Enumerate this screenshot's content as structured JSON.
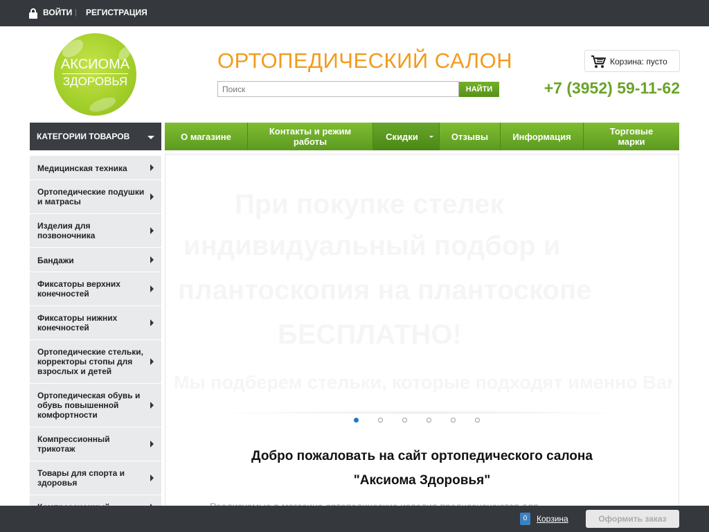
{
  "topbar": {
    "login_label": "ВОЙТИ",
    "separator": "|",
    "register_label": "РЕГИСТРАЦИЯ"
  },
  "logo": {
    "line1": "АКСИОМА",
    "line2": "ЗДОРОВЬЯ"
  },
  "header": {
    "site_title": "ОРТОПЕДИЧЕСКИЙ САЛОН",
    "search_placeholder": "Поиск",
    "search_button": "НАЙТИ",
    "cart_label": "Корзина: пусто",
    "phone": "+7 (3952) 59-11-62"
  },
  "categories_header": "КАТЕГОРИИ ТОВАРОВ",
  "nav": [
    {
      "label": "О магазине"
    },
    {
      "label": "Контакты и режим работы"
    },
    {
      "label": "Скидки"
    },
    {
      "label": "Отзывы"
    },
    {
      "label": "Информация"
    },
    {
      "label": "Торговые марки"
    }
  ],
  "sidebar": {
    "items": [
      {
        "label": "Медицинская техника"
      },
      {
        "label": "Ортопедические подушки и матрасы"
      },
      {
        "label": "Изделия для позвоночника"
      },
      {
        "label": "Бандажи"
      },
      {
        "label": "Фиксаторы верхних конечностей"
      },
      {
        "label": "Фиксаторы нижних конечностей"
      },
      {
        "label": "Ортопедические стельки, корректоры стопы для взрослых и детей"
      },
      {
        "label": "Ортопедическая обувь и обувь повышенной комфортности"
      },
      {
        "label": "Компрессионный трикотаж"
      },
      {
        "label": "Товары для спорта и здоровья"
      },
      {
        "label": "Компрессионный"
      }
    ]
  },
  "banner": {
    "line1": "При покупке стелек",
    "line2": "индивидуальный подбор и",
    "line3": "плантоскопия на плантоскопе",
    "line4": "БЕСПЛАТНО!",
    "line5": "Мы подберем стельки, которые подходят именно Вам!",
    "slides": 6,
    "active_slide": 1
  },
  "welcome": {
    "line1": "Добро пожаловать на сайт ортопедического салона",
    "line2": "\"Аксиома Здоровья\"",
    "cut_text": "Реализуемые в магазине ортопедические изделия предназначаются для"
  },
  "footer": {
    "cart_count": "0",
    "cart_label": "Корзина",
    "checkout_label": "Оформить заказ"
  },
  "colors": {
    "topbar": "#35383d",
    "accent_green": "#6aa32a",
    "title_orange": "#f29b1d",
    "dot_active": "#1e78c8"
  }
}
